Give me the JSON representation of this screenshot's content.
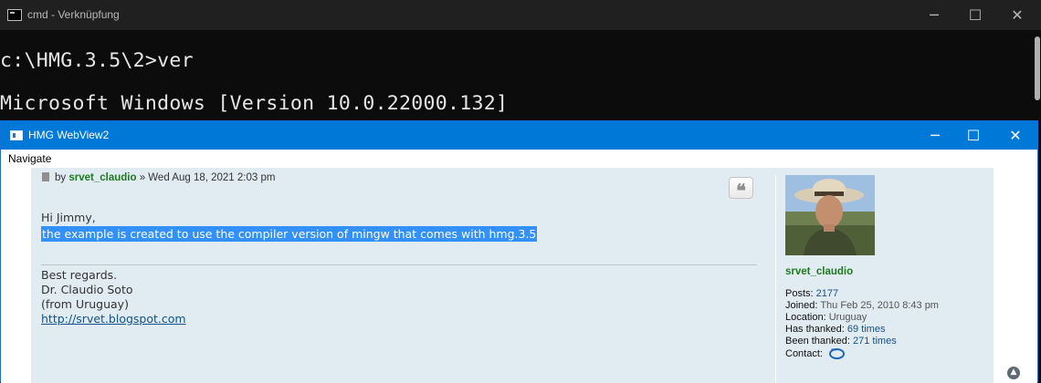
{
  "cmd": {
    "title": "cmd - Verknüpfung",
    "lines": [
      "c:\\HMG.3.5\\2>ver",
      "Microsoft Windows [Version 10.0.22000.132]"
    ],
    "controls": {
      "minimize": "─",
      "maximize": "☐",
      "close": "✕"
    }
  },
  "webview": {
    "title": "HMG WebView2",
    "controls": {
      "minimize": "─",
      "maximize": "☐",
      "close": "✕"
    },
    "menu": [
      "Navigate"
    ]
  },
  "post": {
    "by_prefix": "by ",
    "author": "srvet_claudio",
    "date": " » Wed Aug 18, 2021 2:03 pm",
    "quote_icon": "quote-icon",
    "greeting": "Hi Jimmy,",
    "selected_text": "the example is created to use the compiler version of mingw that comes with hmg.3.5",
    "signature": [
      "Best regards.",
      "Dr. Claudio Soto",
      "(from Uruguay)"
    ],
    "signature_link": "http://srvet.blogspot.com"
  },
  "profile": {
    "username": "srvet_claudio",
    "posts_label": "Posts: ",
    "posts_value": "2177",
    "joined_label": "Joined: ",
    "joined_value": "Thu Feb 25, 2010 8:43 pm",
    "location_label": "Location: ",
    "location_value": "Uruguay",
    "has_thanked_label": "Has thanked: ",
    "has_thanked_value": "69 times",
    "been_thanked_label": "Been thanked: ",
    "been_thanked_value": "271 times",
    "contact_label": "Contact: ",
    "contact_icon": "chat-bubble-icon"
  },
  "scroll_top_icon": "chevron-up-icon"
}
